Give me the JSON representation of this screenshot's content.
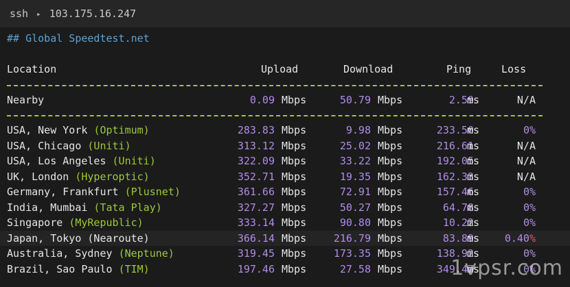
{
  "titlebar": {
    "app": "ssh",
    "host": "103.175.16.247"
  },
  "heading": "## Global Speedtest.net",
  "columns": {
    "location": "Location",
    "upload": "Upload",
    "download": "Download",
    "ping": "Ping",
    "loss": "Loss"
  },
  "nearby": {
    "location": "Nearby",
    "upload": "0.09",
    "download": "50.79",
    "ping": "2.59",
    "loss": "N/A"
  },
  "units": {
    "speed": "Mbps",
    "time": "ms"
  },
  "rows": [
    {
      "place": "USA, New York ",
      "provider": "(Optimum)",
      "upload": "283.83",
      "download": "9.98",
      "ping": "233.50",
      "loss": "0%"
    },
    {
      "place": "USA, Chicago ",
      "provider": "(Uniti)",
      "upload": "313.12",
      "download": "25.02",
      "ping": "216.61",
      "loss": "N/A"
    },
    {
      "place": "USA, Los Angeles ",
      "provider": "(Uniti)",
      "upload": "322.09",
      "download": "33.22",
      "ping": "192.05",
      "loss": "N/A"
    },
    {
      "place": "UK, London ",
      "provider": "(Hyperoptic)",
      "upload": "352.71",
      "download": "19.35",
      "ping": "162.33",
      "loss": "N/A"
    },
    {
      "place": "Germany, Frankfurt ",
      "provider": "(Plusnet)",
      "upload": "361.66",
      "download": "72.91",
      "ping": "157.46",
      "loss": "0%"
    },
    {
      "place": "India, Mumbai ",
      "provider": "(Tata Play)",
      "upload": "327.27",
      "download": "50.27",
      "ping": "64.78",
      "loss": "0%"
    },
    {
      "place": "Singapore ",
      "provider": "(MyRepublic)",
      "upload": "333.14",
      "download": "90.80",
      "ping": "10.22",
      "loss": "0%"
    },
    {
      "place": "Japan, Tokyo (Nearoute)",
      "provider": "",
      "upload": "366.14",
      "download": "216.79",
      "ping": "83.89",
      "loss": "0.40",
      "loss_suffix": "%",
      "highlight": true
    },
    {
      "place": "Australia, Sydney ",
      "provider": "(Neptune)",
      "upload": "319.45",
      "download": "173.35",
      "ping": "138.92",
      "loss": "0%"
    },
    {
      "place": "Brazil, Sao Paulo ",
      "provider": "(TIM)",
      "upload": "197.46",
      "download": "27.58",
      "ping": "349.47",
      "loss": "0%"
    }
  ],
  "watermark": "1vpsr.com",
  "colors": {
    "accent_blue": "#5aa2d8",
    "accent_green": "#9cc93a",
    "accent_purple": "#b08ce8",
    "accent_red": "#e05a5a"
  }
}
